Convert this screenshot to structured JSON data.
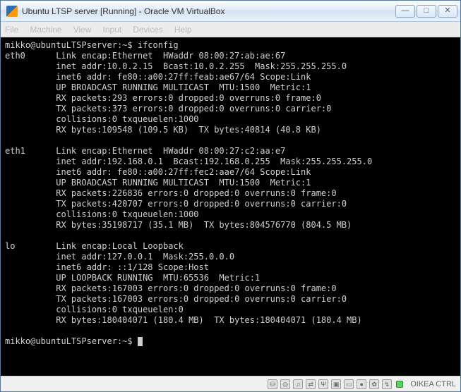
{
  "window": {
    "title": "Ubuntu LTSP server [Running] - Oracle VM VirtualBox"
  },
  "menu": {
    "file": "File",
    "machine": "Machine",
    "view": "View",
    "input": "Input",
    "devices": "Devices",
    "help": "Help"
  },
  "terminal": {
    "prompt1": "mikko@ubuntuLTSPserver:~$ ",
    "command": "ifconfig",
    "output": "eth0      Link encap:Ethernet  HWaddr 08:00:27:ab:ae:67\n          inet addr:10.0.2.15  Bcast:10.0.2.255  Mask:255.255.255.0\n          inet6 addr: fe80::a00:27ff:feab:ae67/64 Scope:Link\n          UP BROADCAST RUNNING MULTICAST  MTU:1500  Metric:1\n          RX packets:293 errors:0 dropped:0 overruns:0 frame:0\n          TX packets:373 errors:0 dropped:0 overruns:0 carrier:0\n          collisions:0 txqueuelen:1000\n          RX bytes:109548 (109.5 KB)  TX bytes:40814 (40.8 KB)\n\neth1      Link encap:Ethernet  HWaddr 08:00:27:c2:aa:e7\n          inet addr:192.168.0.1  Bcast:192.168.0.255  Mask:255.255.255.0\n          inet6 addr: fe80::a00:27ff:fec2:aae7/64 Scope:Link\n          UP BROADCAST RUNNING MULTICAST  MTU:1500  Metric:1\n          RX packets:226836 errors:0 dropped:0 overruns:0 frame:0\n          TX packets:420707 errors:0 dropped:0 overruns:0 carrier:0\n          collisions:0 txqueuelen:1000\n          RX bytes:35198717 (35.1 MB)  TX bytes:804576770 (804.5 MB)\n\nlo        Link encap:Local Loopback\n          inet addr:127.0.0.1  Mask:255.0.0.0\n          inet6 addr: ::1/128 Scope:Host\n          UP LOOPBACK RUNNING  MTU:65536  Metric:1\n          RX packets:167003 errors:0 dropped:0 overruns:0 frame:0\n          TX packets:167003 errors:0 dropped:0 overruns:0 carrier:0\n          collisions:0 txqueuelen:0\n          RX bytes:180404071 (180.4 MB)  TX bytes:180404071 (180.4 MB)\n",
    "prompt2": "mikko@ubuntuLTSPserver:~$ "
  },
  "status": {
    "host_key": "OIKEA CTRL"
  },
  "icons": {
    "hdd": "⛁",
    "cd": "◎",
    "audio": "♫",
    "net": "⇄",
    "usb": "Ψ",
    "share": "▣",
    "display": "▭",
    "rec": "●",
    "cam": "✿",
    "mouse": "↯"
  }
}
